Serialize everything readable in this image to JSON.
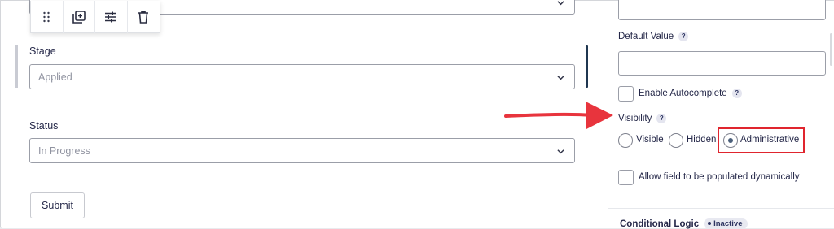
{
  "toolbar": {
    "icons": [
      "drag-handle-icon",
      "duplicate-icon",
      "settings-sliders-icon",
      "trash-icon"
    ]
  },
  "form": {
    "stage_label": "Stage",
    "stage_value": "Applied",
    "status_label": "Status",
    "status_value": "In Progress",
    "submit_label": "Submit"
  },
  "panel": {
    "default_value_label": "Default Value",
    "help_glyph": "?",
    "enable_autocomplete_label": "Enable Autocomplete",
    "visibility_label": "Visibility",
    "visibility_options": [
      {
        "label": "Visible",
        "selected": false
      },
      {
        "label": "Hidden",
        "selected": false
      },
      {
        "label": "Administrative",
        "selected": true
      }
    ],
    "populate_dynamically_label": "Allow field to be populated dynamically",
    "conditional_logic_label": "Conditional Logic",
    "conditional_logic_status": "Inactive"
  },
  "colors": {
    "text": "#242748",
    "placeholder": "#9093a0",
    "highlight_red": "#e0252e",
    "arrow_red": "#e8343d",
    "selected_bar": "#1f3650"
  }
}
